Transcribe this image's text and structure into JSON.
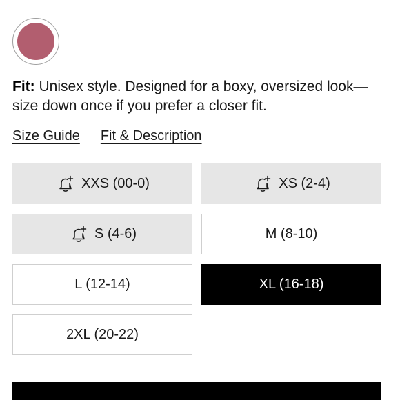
{
  "product": {
    "swatch": {
      "color": "#b25e6f",
      "selected": true
    },
    "fit": {
      "label": "Fit:",
      "text": "Unisex style. Designed for a boxy, oversized look—size down once if you prefer a closer fit."
    },
    "links": {
      "size_guide": "Size Guide",
      "fit_description": "Fit & Description"
    },
    "sizes": [
      {
        "label": "XXS (00-0)",
        "available": false,
        "selected": false,
        "icon": "bell-plus-icon"
      },
      {
        "label": "XS (2-4)",
        "available": false,
        "selected": false,
        "icon": "bell-plus-icon"
      },
      {
        "label": "S (4-6)",
        "available": false,
        "selected": false,
        "icon": "bell-plus-icon"
      },
      {
        "label": "M (8-10)",
        "available": true,
        "selected": false
      },
      {
        "label": "L (12-14)",
        "available": true,
        "selected": false
      },
      {
        "label": "XL (16-18)",
        "available": true,
        "selected": true
      },
      {
        "label": "2XL (20-22)",
        "available": true,
        "selected": false
      }
    ]
  }
}
